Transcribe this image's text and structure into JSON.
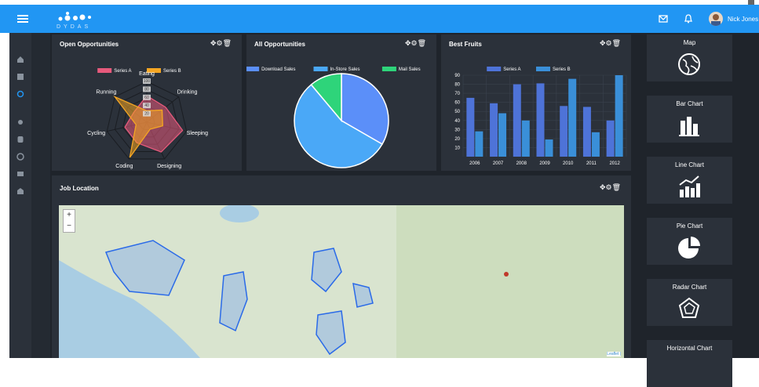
{
  "header": {
    "logo_text": "DYDAS",
    "user_name": "Nick Jones"
  },
  "panels": {
    "open": {
      "title": "Open Opportunities"
    },
    "all": {
      "title": "All Opportunities"
    },
    "fruits": {
      "title": "Best Fruits"
    },
    "job": {
      "title": "Job Location"
    }
  },
  "right_cards": [
    {
      "label": "Map",
      "icon": "globe-icon"
    },
    {
      "label": "Bar Chart",
      "icon": "bar-chart-icon"
    },
    {
      "label": "Line Chart",
      "icon": "line-chart-icon"
    },
    {
      "label": "Pie Chart",
      "icon": "pie-chart-icon"
    },
    {
      "label": "Radar Chart",
      "icon": "radar-chart-icon"
    },
    {
      "label": "Horizontal Chart",
      "icon": "horizontal-chart-icon"
    }
  ],
  "map": {
    "zoom_in": "+",
    "zoom_out": "−",
    "attribution": "Leaflet |"
  },
  "chart_data": [
    {
      "type": "radar",
      "categories": [
        "Eating",
        "Drinking",
        "Sleeping",
        "Designing",
        "Coding",
        "Cycling",
        "Running"
      ],
      "series": [
        {
          "name": "Series A",
          "values": [
            65,
            59,
            90,
            81,
            56,
            55,
            40
          ],
          "color": "#e75a7c"
        },
        {
          "name": "Series B",
          "values": [
            28,
            48,
            40,
            19,
            96,
            27,
            100
          ],
          "color": "#f5a623"
        }
      ],
      "legend": "top"
    },
    {
      "type": "pie",
      "series": [
        {
          "name": "Download Sales",
          "value": 300,
          "color": "#5b8ff9"
        },
        {
          "name": "In-Store Sales",
          "value": 500,
          "color": "#4aa8f7"
        },
        {
          "name": "Mail Sales",
          "value": 100,
          "color": "#2ed47a"
        }
      ],
      "legend": "top"
    },
    {
      "type": "bar",
      "categories": [
        "2006",
        "2007",
        "2008",
        "2009",
        "2010",
        "2011",
        "2012"
      ],
      "series": [
        {
          "name": "Series A",
          "values": [
            65,
            59,
            80,
            81,
            56,
            55,
            40
          ],
          "color": "#4e73d8"
        },
        {
          "name": "Series B",
          "values": [
            28,
            48,
            40,
            19,
            86,
            27,
            90
          ],
          "color": "#3a8fd8"
        }
      ],
      "yticks": [
        10,
        20,
        30,
        40,
        50,
        60,
        70,
        80,
        90
      ],
      "ylim": [
        0,
        90
      ],
      "legend": "top"
    }
  ]
}
